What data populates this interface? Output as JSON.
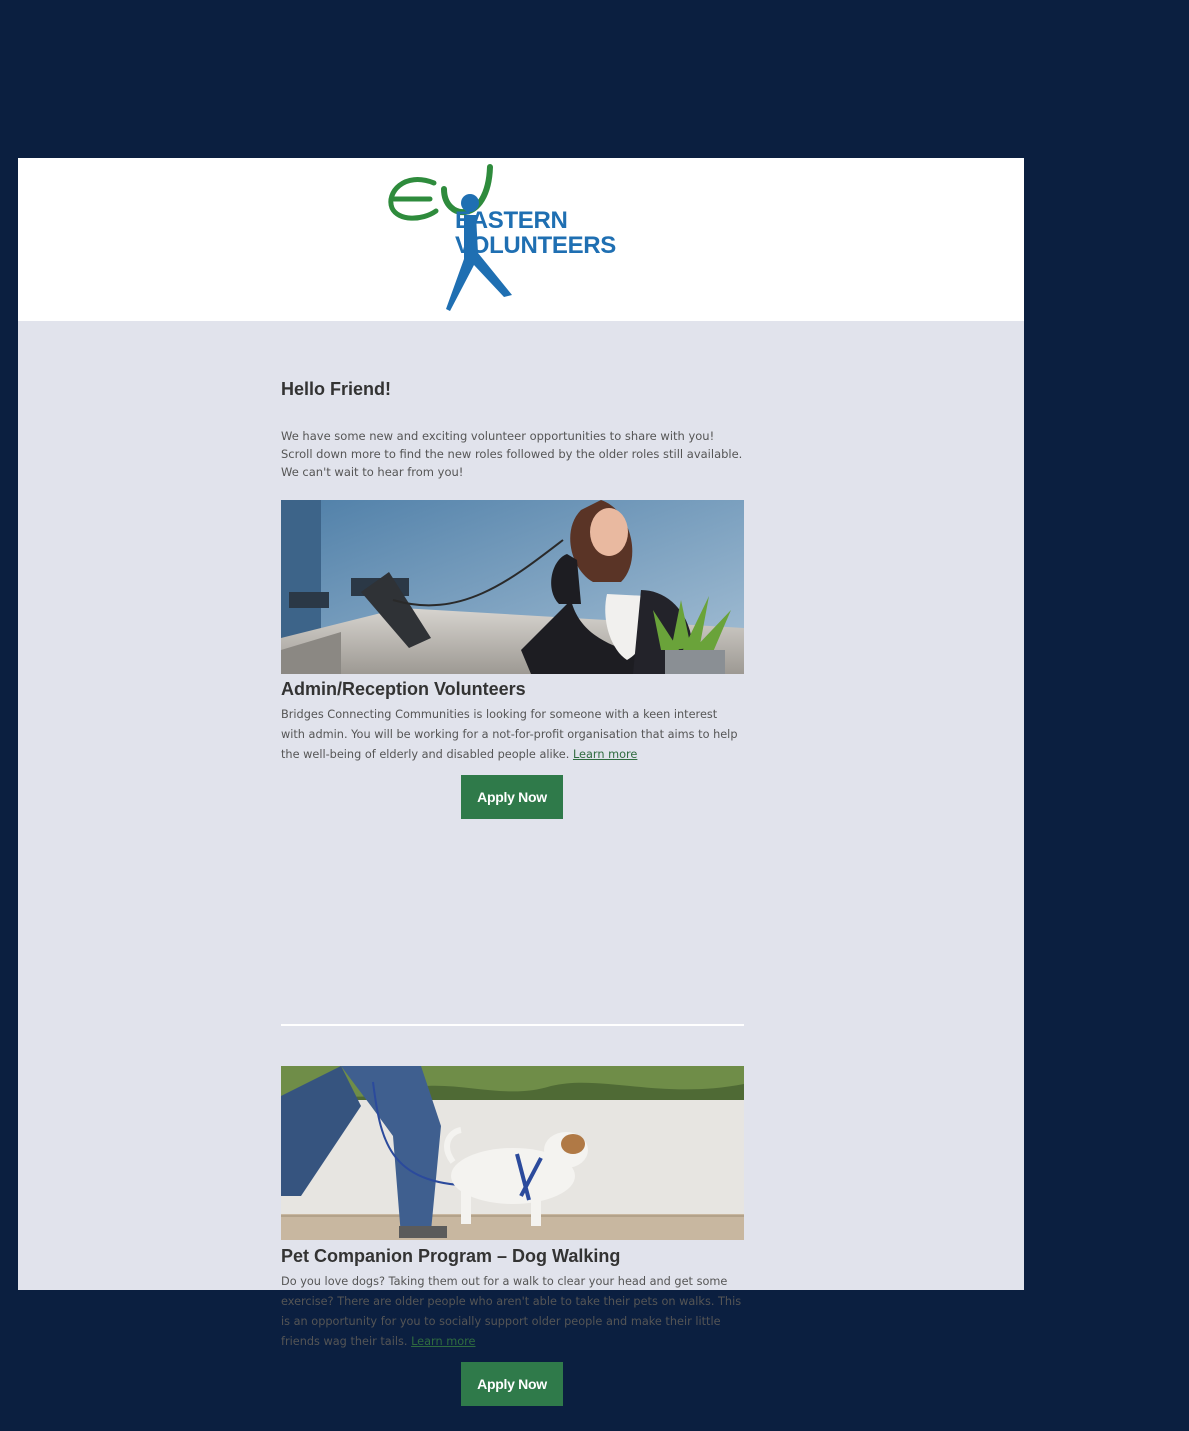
{
  "brand": {
    "name_line1": "EASTERN",
    "name_line2": "VOLUNTEERS",
    "colors": {
      "green": "#2e8b3c",
      "blue": "#1f6fb2"
    }
  },
  "greeting": "Hello Friend!",
  "intro": "We have some new and exciting volunteer opportunities to share with you! Scroll down more to find the new roles followed by the older roles still available. We can't wait to hear from you!",
  "roles": [
    {
      "title": "Admin/Reception Volunteers",
      "description": "Bridges Connecting Communities is looking for someone with a keen interest with admin. You will be working for a not-for-profit organisation that aims to help the well-being of elderly and disabled people alike.",
      "learn_more": "Learn more",
      "apply": "Apply Now",
      "image": "receptionist-on-phone-photo"
    },
    {
      "title": "Pet Companion Program – Dog Walking",
      "description": "Do you love dogs? Taking them out for a walk to clear your head and get some exercise? There are older people who aren't able to take their pets on walks. This is an opportunity for you to socially support older people and make their little friends wag their tails.",
      "learn_more": "Learn more",
      "apply": "Apply Now",
      "image": "dog-walking-photo"
    }
  ],
  "colors": {
    "page_background": "#0b1f40",
    "email_background": "#e1e3ec",
    "button": "#2f7a4a",
    "link": "#2f6b3f"
  }
}
